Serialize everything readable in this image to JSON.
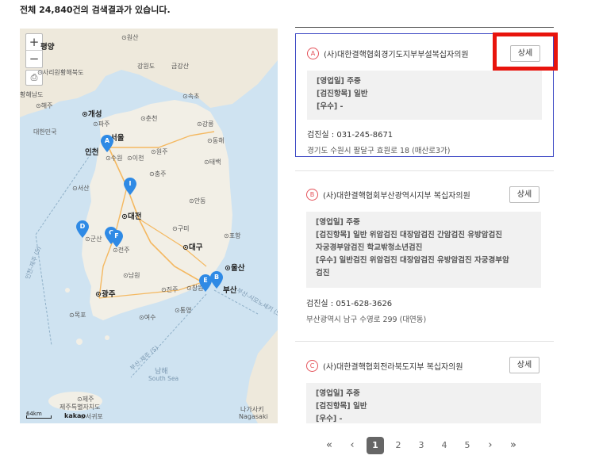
{
  "summary": {
    "text": "전체 24,840건의 검색결과가 있습니다."
  },
  "map": {
    "zoom_in": "+",
    "zoom_out": "−",
    "print_icon": "⎙",
    "cities": [
      {
        "name": "평양",
        "cls": "big"
      },
      {
        "name": "⊙원산",
        "cls": ""
      },
      {
        "name": "강원도",
        "cls": ""
      },
      {
        "name": "금강산",
        "cls": ""
      },
      {
        "name": "⊙사리원",
        "cls": ""
      },
      {
        "name": "황해북도",
        "cls": ""
      },
      {
        "name": "황해남도",
        "cls": ""
      },
      {
        "name": "⊙해주",
        "cls": ""
      },
      {
        "name": "⊙개성",
        "cls": ""
      },
      {
        "name": "⊙속초",
        "cls": ""
      },
      {
        "name": "⊙춘천",
        "cls": ""
      },
      {
        "name": "⊙파주",
        "cls": ""
      },
      {
        "name": "⊙강릉",
        "cls": ""
      },
      {
        "name": "서울",
        "cls": "big"
      },
      {
        "name": "대한민국",
        "cls": ""
      },
      {
        "name": "⊙동해",
        "cls": ""
      },
      {
        "name": "인천",
        "cls": "big"
      },
      {
        "name": "⊙수원",
        "cls": ""
      },
      {
        "name": "⊙이천",
        "cls": ""
      },
      {
        "name": "⊙원주",
        "cls": ""
      },
      {
        "name": "⊙태백",
        "cls": ""
      },
      {
        "name": "⊙충주",
        "cls": ""
      },
      {
        "name": "⊙서산",
        "cls": ""
      },
      {
        "name": "⊙안동",
        "cls": ""
      },
      {
        "name": "⊙대전",
        "cls": "big"
      },
      {
        "name": "⊙구미",
        "cls": ""
      },
      {
        "name": "⊙포항",
        "cls": ""
      },
      {
        "name": "⊙군산",
        "cls": ""
      },
      {
        "name": "⊙전주",
        "cls": ""
      },
      {
        "name": "⊙대구",
        "cls": "big"
      },
      {
        "name": "⊙울산",
        "cls": "big"
      },
      {
        "name": "⊙남원",
        "cls": ""
      },
      {
        "name": "⊙광주",
        "cls": "big"
      },
      {
        "name": "⊙진주",
        "cls": ""
      },
      {
        "name": "⊙창원",
        "cls": ""
      },
      {
        "name": "부산",
        "cls": "big"
      },
      {
        "name": "⊙목포",
        "cls": ""
      },
      {
        "name": "⊙여수",
        "cls": ""
      },
      {
        "name": "⊙통영",
        "cls": ""
      },
      {
        "name": "남해",
        "cls": "sea"
      },
      {
        "name": "South Sea",
        "cls": "sea-sm"
      },
      {
        "name": "⊙제주",
        "cls": ""
      },
      {
        "name": "제주특별자치도",
        "cls": ""
      },
      {
        "name": "⊙서귀포",
        "cls": ""
      },
      {
        "name": "나가사키",
        "cls": ""
      },
      {
        "name": "Nagasaki",
        "cls": ""
      },
      {
        "name": "부산-시모노세키 (S)",
        "cls": "sea-sm"
      },
      {
        "name": "부산-제주 (S)",
        "cls": "sea-sm"
      },
      {
        "name": "인천-제주 (S)",
        "cls": "sea-sm"
      }
    ],
    "pins": [
      {
        "label": "A"
      },
      {
        "label": "I"
      },
      {
        "label": "D"
      },
      {
        "label": "C"
      },
      {
        "label": "F"
      },
      {
        "label": "E"
      },
      {
        "label": "B"
      }
    ],
    "scale_label": "64km",
    "brand": "kakao",
    "pin_color": "#2f8ae5"
  },
  "results": [
    {
      "letter": "A",
      "name": "(사)대한결핵협회경기도지부부설복십자의원",
      "detail_label": "상세",
      "info": [
        "[영업일] 주중",
        "[검진항목] 일반",
        "[우수] -"
      ],
      "phone": "검진실 : 031-245-8671",
      "address": "경기도 수원시 팔달구 효원로 18 (매산로3가)"
    },
    {
      "letter": "B",
      "name": "(사)대한결핵협회부산광역시지부 복십자의원",
      "detail_label": "상세",
      "info": [
        "[영업일] 주중",
        "[검진항목] 일반 위암검진 대장암검진 간암검진 유방암검진",
        "자궁경부암검진 학교밖청소년검진",
        "[우수] 일반검진 위암검진 대장암검진 유방암검진 자궁경부암",
        "검진"
      ],
      "phone": "검진실 : 051-628-3626",
      "address": "부산광역시 남구 수영로 299 (대연동)"
    },
    {
      "letter": "C",
      "name": "(사)대한결핵협회전라북도지부 복십자의원",
      "detail_label": "상세",
      "info": [
        "[영업일] 주중",
        "[검진항목] 일반",
        "[우수] -"
      ]
    }
  ],
  "pagination": {
    "first": "«",
    "prev": "‹",
    "pages": [
      "1",
      "2",
      "3",
      "4",
      "5"
    ],
    "next": "›",
    "last": "»",
    "active": "1"
  },
  "colors": {
    "selected_border": "#3b47c4",
    "highlight": "#e8140d",
    "badge": "#e4525a"
  }
}
